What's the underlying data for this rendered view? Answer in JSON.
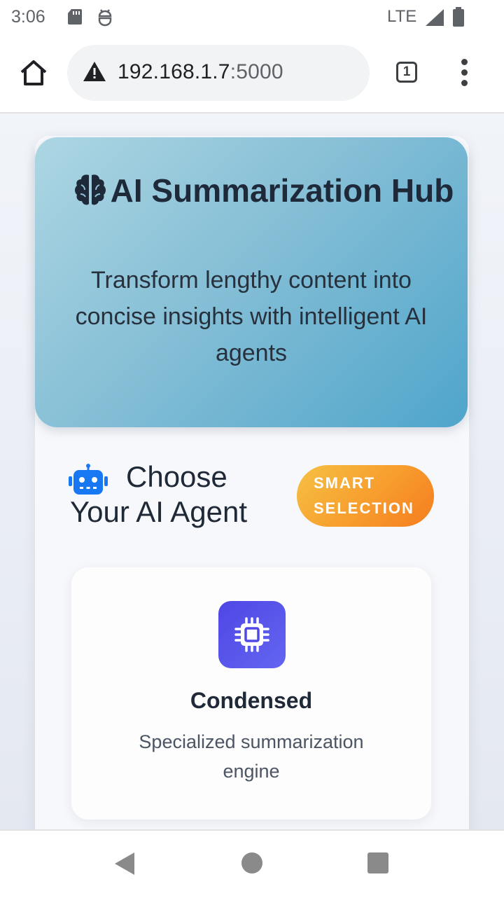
{
  "status_bar": {
    "time": "3:06",
    "network": "LTE",
    "icons": [
      "sd-card-icon",
      "debug-icon",
      "signal-icon",
      "battery-icon"
    ]
  },
  "browser": {
    "url_host": "192.168.1.7",
    "url_port": ":5000",
    "tab_count": "1",
    "icons": [
      "home-icon",
      "warning-icon",
      "tabs-icon",
      "more-vert-icon"
    ]
  },
  "hero": {
    "icon": "brain-icon",
    "title": "AI Summarization Hub",
    "subtitle": "Transform lengthy content into concise insights with intelligent AI agents"
  },
  "agent_section": {
    "icon": "robot-icon",
    "title": "Choose Your AI Agent",
    "badge": "SMART SELECTION"
  },
  "agent_card": {
    "icon": "chip-icon",
    "name": "Condensed",
    "description": "Specialized summarization engine"
  },
  "colors": {
    "hero_gradient": [
      "#add6e3",
      "#4fa5cb"
    ],
    "badge_gradient": [
      "#f6c144",
      "#f57c1f"
    ],
    "chip_tile": "#5148e6",
    "robot_icon": "#1877f2"
  }
}
